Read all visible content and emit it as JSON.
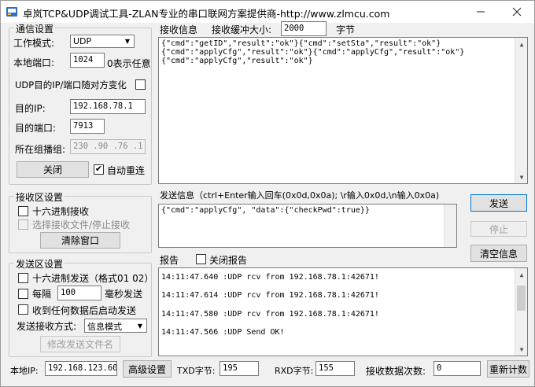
{
  "title": "卓岚TCP&UDP调试工具-ZLAN专业的串口联网方案提供商-http://www.zlmcu.com",
  "comm": {
    "group_title": "通信设置",
    "work_mode_label": "工作模式:",
    "work_mode_value": "UDP",
    "local_port_label": "本地端口:",
    "local_port_value": "1024",
    "local_port_hint": "0表示任意",
    "udp_follow_label": "UDP目的IP/端口随对方变化",
    "dest_ip_label": "目的IP:",
    "dest_ip_value": "192.168.78.1",
    "dest_port_label": "目的端口:",
    "dest_port_value": "7913",
    "multicast_label": "所在组播组:",
    "multicast_value": "230 .90 .76 .1",
    "close_button": "关闭",
    "auto_reconnect_label": "自动重连",
    "auto_reconnect_checked": "✔"
  },
  "recv_settings": {
    "group_title": "接收区设置",
    "hex_recv_label": "十六进制接收",
    "select_file_label": "选择接收文件/停止接收",
    "clear_button": "清除窗口"
  },
  "send_settings": {
    "group_title": "发送区设置",
    "hex_send_label": "十六进制发送（格式01 02）",
    "every_label": "每隔",
    "every_value": "100",
    "ms_send_label": "毫秒发送",
    "recv_then_send_label": "收到任何数据后启动发送",
    "mode_label": "发送接收方式:",
    "mode_value": "信息模式",
    "modify_file_button": "修改发送文件名"
  },
  "recv_area": {
    "title": "接收信息",
    "buffer_label": "接收缓冲大小:",
    "buffer_value": "2000",
    "buffer_unit": "字节",
    "lines": [
      "{\"cmd\":\"getID\",\"result\":\"ok\"}{\"cmd\":\"setSta\",\"result\":\"ok\"}",
      "{\"cmd\":\"applyCfg\",\"result\":\"ok\"}{\"cmd\":\"applyCfg\",\"result\":\"ok\"}",
      "{\"cmd\":\"applyCfg\",\"result\":\"ok\"}"
    ]
  },
  "send_area": {
    "title": "发送信息（ctrl+Enter输入回车(0x0d,0x0a); \\r输入0x0d,\\n输入0x0a)",
    "content": "{\"cmd\":\"applyCfg\", \"data\":{\"checkPwd\":true}}",
    "send_button": "发送",
    "stop_button": "停止",
    "clear_button": "清空信息"
  },
  "report": {
    "title": "报告",
    "close_report_label": "关闭报告",
    "lines": [
      "14:11:47.640 :UDP rcv from 192.168.78.1:42671!",
      "14:11:47.614 :UDP rcv from 192.168.78.1:42671!",
      "14:11:47.580 :UDP rcv from 192.168.78.1:42671!",
      "14:11:47.566 :UDP Send OK!"
    ]
  },
  "status": {
    "local_ip_label": "本地IP:",
    "local_ip_value": "192.168.123.60",
    "advanced_button": "高级设置",
    "txd_label": "TXD字节:",
    "txd_value": "195",
    "rxd_label": "RXD字节:",
    "rxd_value": "155",
    "recv_count_label": "接收数据次数:",
    "recv_count_value": "0",
    "reset_button": "重新计数"
  },
  "icons": {
    "app": "app-icon",
    "minimize": "minimize-icon",
    "close": "close-icon"
  }
}
